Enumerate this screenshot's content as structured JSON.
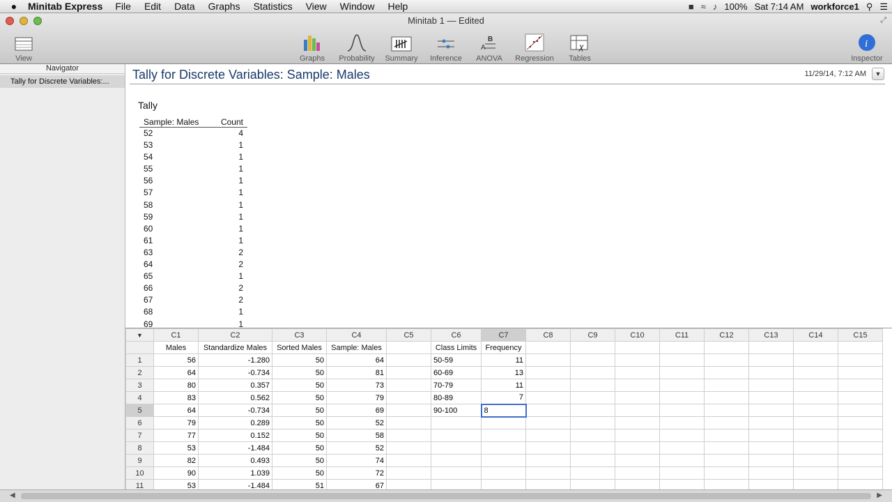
{
  "menubar": {
    "app": "Minitab Express",
    "items": [
      "File",
      "Edit",
      "Data",
      "Graphs",
      "Statistics",
      "View",
      "Window",
      "Help"
    ],
    "battery": "100%",
    "clock": "Sat 7:14 AM",
    "user": "workforce1"
  },
  "window": {
    "title": "Minitab 1 — Edited",
    "toolbar": [
      "View",
      "Graphs",
      "Probability",
      "Summary",
      "Inference",
      "ANOVA",
      "Regression",
      "Tables",
      "Inspector"
    ]
  },
  "navigator": {
    "header": "Navigator",
    "item": "Tally for Discrete Variables:..."
  },
  "output": {
    "title": "Tally for Discrete Variables: Sample: Males",
    "date": "11/29/14, 7:12 AM",
    "section": "Tally",
    "headers": [
      "Sample: Males",
      "Count"
    ],
    "rows": [
      [
        "52",
        "4"
      ],
      [
        "53",
        "1"
      ],
      [
        "54",
        "1"
      ],
      [
        "55",
        "1"
      ],
      [
        "56",
        "1"
      ],
      [
        "57",
        "1"
      ],
      [
        "58",
        "1"
      ],
      [
        "59",
        "1"
      ],
      [
        "60",
        "1"
      ],
      [
        "61",
        "1"
      ],
      [
        "63",
        "2"
      ],
      [
        "64",
        "2"
      ],
      [
        "65",
        "1"
      ],
      [
        "66",
        "2"
      ],
      [
        "67",
        "2"
      ],
      [
        "68",
        "1"
      ],
      [
        "69",
        "1"
      ]
    ]
  },
  "worksheet": {
    "columns": [
      "C1",
      "C2",
      "C3",
      "C4",
      "C5",
      "C6",
      "C7",
      "C8",
      "C9",
      "C10",
      "C11",
      "C12",
      "C13",
      "C14",
      "C15"
    ],
    "names": [
      "Males",
      "Standardize Males",
      "Sorted Males",
      "Sample: Males",
      "",
      "Class Limits",
      "Frequency",
      "",
      "",
      "",
      "",
      "",
      "",
      "",
      ""
    ],
    "rows": [
      [
        "1",
        "56",
        "-1.280",
        "50",
        "64",
        "",
        "50-59",
        "11"
      ],
      [
        "2",
        "64",
        "-0.734",
        "50",
        "81",
        "",
        "60-69",
        "13"
      ],
      [
        "3",
        "80",
        "0.357",
        "50",
        "73",
        "",
        "70-79",
        "11"
      ],
      [
        "4",
        "83",
        "0.562",
        "50",
        "79",
        "",
        "80-89",
        "7"
      ],
      [
        "5",
        "64",
        "-0.734",
        "50",
        "69",
        "",
        "90-100",
        "8"
      ],
      [
        "6",
        "79",
        "0.289",
        "50",
        "52",
        "",
        "",
        ""
      ],
      [
        "7",
        "77",
        "0.152",
        "50",
        "58",
        "",
        "",
        ""
      ],
      [
        "8",
        "53",
        "-1.484",
        "50",
        "52",
        "",
        "",
        ""
      ],
      [
        "9",
        "82",
        "0.493",
        "50",
        "74",
        "",
        "",
        ""
      ],
      [
        "10",
        "90",
        "1.039",
        "50",
        "72",
        "",
        "",
        ""
      ],
      [
        "11",
        "53",
        "-1.484",
        "51",
        "67",
        "",
        "",
        ""
      ]
    ]
  }
}
